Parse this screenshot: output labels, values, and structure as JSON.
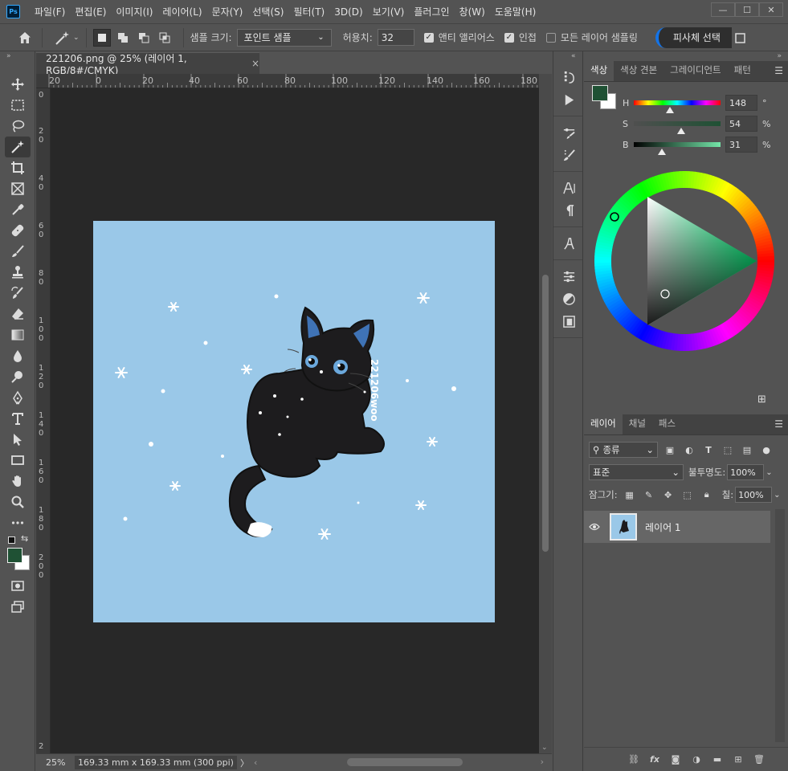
{
  "app": {
    "logo": "Ps",
    "menu": [
      "파일(F)",
      "편집(E)",
      "이미지(I)",
      "레이어(L)",
      "문자(Y)",
      "선택(S)",
      "필터(T)",
      "3D(D)",
      "보기(V)",
      "플러그인",
      "창(W)",
      "도움말(H)"
    ],
    "window_controls": [
      "—",
      "☐",
      "✕"
    ]
  },
  "options": {
    "sample_size_label": "샘플 크기:",
    "sample_size_value": "포인트 샘플",
    "tolerance_label": "허용치:",
    "tolerance_value": "32",
    "antialias_label": "앤티 앨리어스",
    "antialias_checked": true,
    "contiguous_label": "인접",
    "contiguous_checked": true,
    "all_layers_label": "모든 레이어 샘플링",
    "all_layers_checked": false,
    "subject_button": "피사체 선택"
  },
  "document": {
    "tab_title": "221206.png @ 25% (레이어 1, RGB/8#/CMYK)",
    "close": "×",
    "ruler_top": [
      "20",
      "0",
      "20",
      "40",
      "60",
      "80",
      "100",
      "120",
      "140",
      "160",
      "180"
    ],
    "ruler_left": [
      "0",
      "2\n0",
      "4\n0",
      "6\n0",
      "8\n0",
      "1\n0\n0",
      "1\n2\n0",
      "1\n4\n0",
      "1\n6\n0",
      "1\n8\n0",
      "2\n0\n0",
      "2"
    ],
    "artwork_text": "221206woo",
    "background_color": "#9ac8e8"
  },
  "status": {
    "zoom": "25%",
    "dimensions": "169.33 mm x 169.33 mm (300 ppi)",
    "chevron": "〉"
  },
  "color_panel": {
    "tabs": [
      "색상",
      "색상 견본",
      "그레이디언트",
      "패턴"
    ],
    "active_tab": 0,
    "foreground": "#1f5134",
    "background": "#ffffff",
    "h_label": "H",
    "h_value": "148",
    "h_unit": "°",
    "s_label": "S",
    "s_value": "54",
    "s_unit": "%",
    "b_label": "B",
    "b_value": "31",
    "b_unit": "%",
    "add_icon": "⊞"
  },
  "layers_panel": {
    "tabs": [
      "레이어",
      "채널",
      "패스"
    ],
    "active_tab": 0,
    "filter_kind": "종류",
    "blend_mode": "표준",
    "opacity_label": "불투명도:",
    "opacity_value": "100%",
    "lock_label": "잠그기:",
    "fill_label": "칠:",
    "fill_value": "100%",
    "layers": [
      {
        "name": "레이어 1",
        "visible": true
      }
    ]
  }
}
